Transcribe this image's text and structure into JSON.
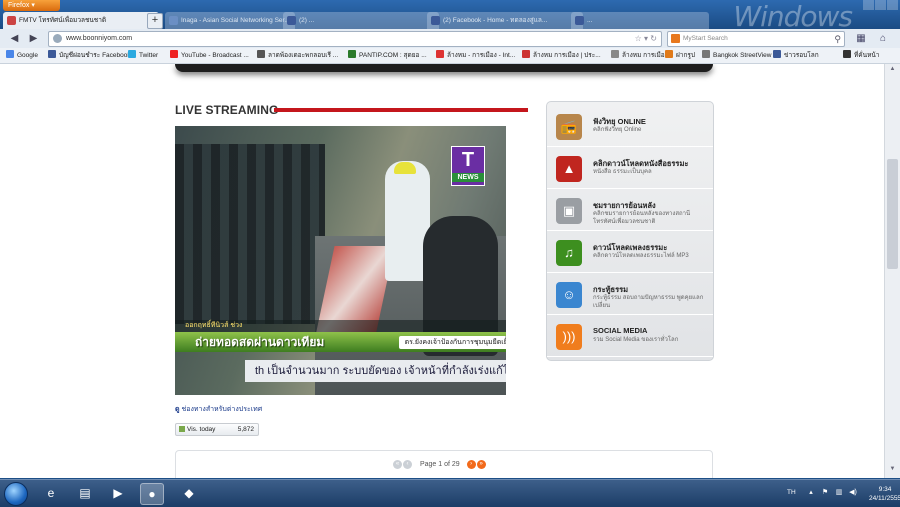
{
  "browser": {
    "menu_button_label": "Firefox",
    "watermark": "Windows",
    "tabs": [
      {
        "title": "FMTV โทรทัศน์เพื่อมวลชนชาติ",
        "active": true
      },
      {
        "title": "Inaga - Asian Social Networking Ser...",
        "active": false
      },
      {
        "title": "(2) ...",
        "active": false
      },
      {
        "title": "(2) Facebook - Home - ทดลองสู่แล...",
        "active": false
      },
      {
        "title": "...",
        "active": false
      }
    ],
    "new_tab_label": "+",
    "url": "www.boonniyom.com",
    "search_placeholder": "MyStart Search",
    "bookmarks": [
      {
        "label": "Google",
        "color": "#4a86e8"
      },
      {
        "label": "บัญชีผ่อนชำระ Facebook",
        "color": "#3b5998"
      },
      {
        "label": "Twitter",
        "color": "#2aa9e0"
      },
      {
        "label": "YouTube - Broadcast ...",
        "color": "#e22"
      },
      {
        "label": "ลาดพ้องเดอะพกลอบเรี ...",
        "color": "#555"
      },
      {
        "label": "PANTIP.COM : สุดยอ ...",
        "color": "#2b7a2b"
      },
      {
        "label": "ล้างหม - การเมือง - Int...",
        "color": "#d33"
      },
      {
        "label": "ล้างหม การเมือง | ประ...",
        "color": "#c33"
      },
      {
        "label": "ล้างหม การเมือง",
        "color": "#888"
      },
      {
        "label": "ฝากรูป",
        "color": "#e07a1a"
      },
      {
        "label": "Bangkok StreetView",
        "color": "#777"
      },
      {
        "label": "ข่าวรอบโลก",
        "color": "#3b5998"
      },
      {
        "label": "ที่คั่นหน้า",
        "color": "#333"
      }
    ]
  },
  "page": {
    "section_title": "LIVE STREAMING",
    "video": {
      "channel_logo": "T",
      "channel_logo_sub": "NEWS",
      "ticker_top": "ออกฤทธิ์ทีนิวส์ ช่วง",
      "ticker_main": "ถ่ายทอดสดผ่านดาวเทียม",
      "ticker_main_right": "ตร.ยังคงเจ้าป้องกันการชุมนุมยืดเยื้อ",
      "ticker_bottom": "th เป็นจำนวนมาก ระบบยัดของ เจ้าหน้าที่กำลังเร่งแก้ไข"
    },
    "channel_link_prefix": "ดู",
    "channel_link": "ช่องทางสำหรับต่างประเทศ",
    "visits_label": "Vis. today",
    "visits_value": "5,872",
    "pager_text": "Page 1 of 29",
    "sidebar": [
      {
        "title": "ฟังวิทยุ ONLINE",
        "sub": "คลิกฟังวิทยุ Online",
        "icon": "radio-icon",
        "color": "#b8864b",
        "glyph": "📻"
      },
      {
        "title": "คลิกดาวน์โหลดหนังสือธรรมะ",
        "sub": "หนังสือ ธรรมะเป็นบุคล",
        "icon": "pdf-icon",
        "color": "#c0261f",
        "glyph": "▲"
      },
      {
        "title": "ชมรายการย้อนหลัง",
        "sub": "คลิกชมรายการย้อนหลังของทางสถานีโทรทัศน์เพื่อมวลชนชาติ",
        "icon": "film-icon",
        "color": "#9a9ea3",
        "glyph": "▣"
      },
      {
        "title": "ดาวน์โหลดเพลงธรรมะ",
        "sub": "คลิกดาวน์โหลดเพลงธรรมะไฟล์ MP3",
        "icon": "music-icon",
        "color": "#3d8f1f",
        "glyph": "♫"
      },
      {
        "title": "กระทู้ธรรม",
        "sub": "กระทู้ธรรม สอบถามปัญหาธรรม พูดคุยแลกเปลี่ยน",
        "icon": "chat-icon",
        "color": "#3a86d0",
        "glyph": "☺"
      },
      {
        "title": "SOCIAL MEDIA",
        "sub": "รวม Social Media ของเราทั่วโลก",
        "icon": "rss-icon",
        "color": "#f07d1d",
        "glyph": ")))"
      }
    ]
  },
  "taskbar": {
    "language": "TH",
    "time": "9:34",
    "date": "24/11/2555",
    "apps": [
      {
        "name": "internet-explorer-icon",
        "glyph": "e",
        "active": false
      },
      {
        "name": "file-explorer-icon",
        "glyph": "▤",
        "active": false
      },
      {
        "name": "media-player-icon",
        "glyph": "▶",
        "active": false
      },
      {
        "name": "firefox-icon",
        "glyph": "●",
        "active": true
      },
      {
        "name": "app-icon",
        "glyph": "◆",
        "active": false
      }
    ]
  },
  "colors": {
    "accent_red": "#c4161c",
    "pager_active": "#f26a1b"
  }
}
